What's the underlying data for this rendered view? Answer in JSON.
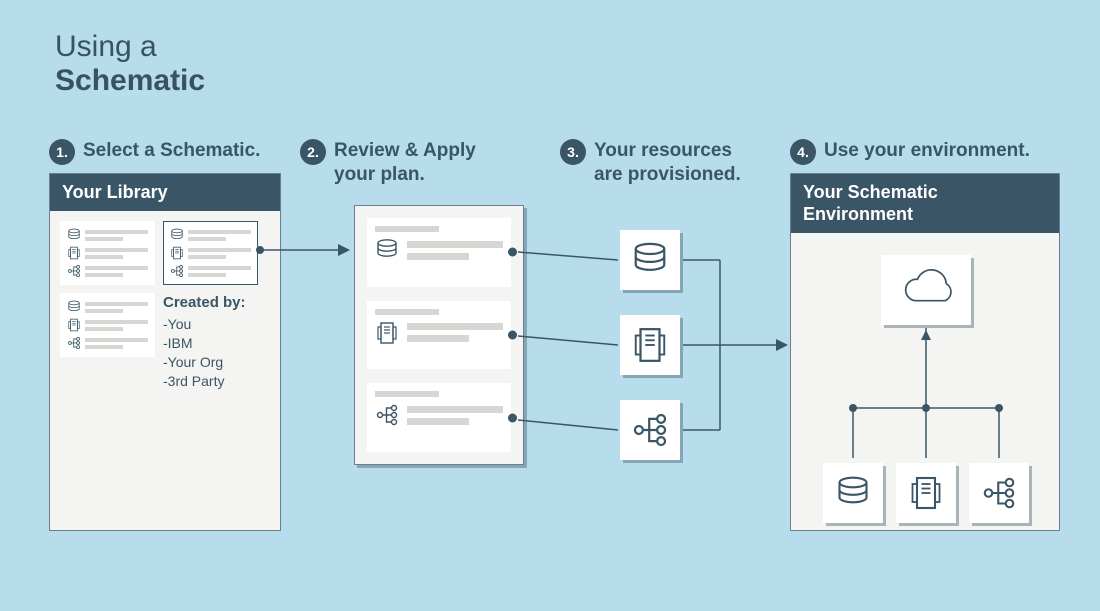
{
  "title": {
    "line1": "Using a",
    "line2": "Schematic"
  },
  "steps": {
    "s1": {
      "num": "1.",
      "text": "Select a Schematic."
    },
    "s2": {
      "num": "2.",
      "text": "Review & Apply\nyour plan."
    },
    "s3": {
      "num": "3.",
      "text": "Your resources\nare provisioned."
    },
    "s4": {
      "num": "4.",
      "text": "Use your environment."
    }
  },
  "library": {
    "header": "Your Library",
    "created_by": {
      "header": "Created by:",
      "items": [
        "-You",
        "-IBM",
        "-Your Org",
        "-3rd Party"
      ]
    }
  },
  "environment": {
    "header": "Your Schematic\nEnvironment"
  },
  "icons": {
    "database": "database-icon",
    "server": "server-icon",
    "network": "network-icon",
    "cloud": "cloud-icon"
  }
}
